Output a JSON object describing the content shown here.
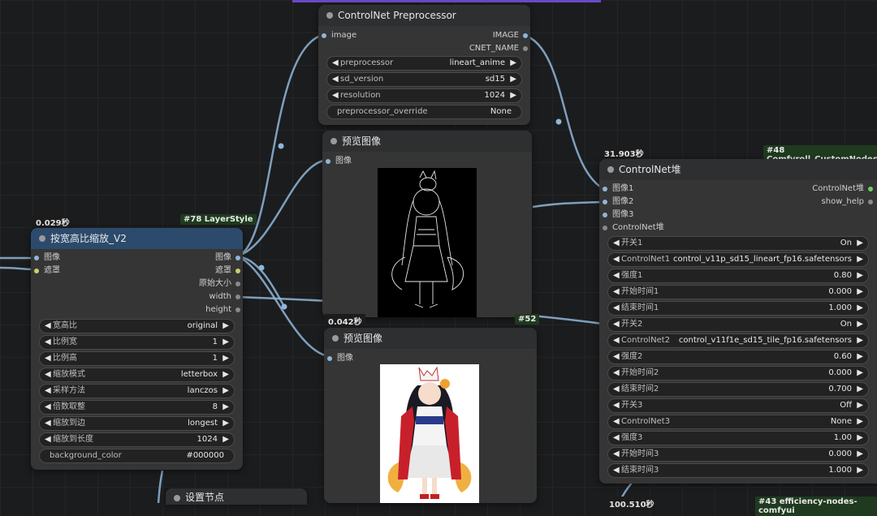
{
  "nodes": {
    "preprocessor": {
      "title": "ControlNet Preprocessor",
      "input_image": "image",
      "out_image": "IMAGE",
      "out_cnet": "CNET_NAME",
      "widgets": [
        {
          "label": "preprocessor",
          "value": "lineart_anime"
        },
        {
          "label": "sd_version",
          "value": "sd15"
        },
        {
          "label": "resolution",
          "value": "1024"
        }
      ],
      "override": {
        "label": "preprocessor_override",
        "value": "None"
      }
    },
    "preview1": {
      "title": "预览图像",
      "input": "图像"
    },
    "preview2": {
      "title": "预览图像",
      "input": "图像",
      "time": "0.042秒",
      "badge": "#52"
    },
    "resize": {
      "title": "按宽高比缩放_V2",
      "time": "0.029秒",
      "badge": "#78 LayerStyle",
      "inputs": [
        "图像",
        "遮罩"
      ],
      "outputs": [
        "图像",
        "遮罩",
        "原始大小",
        "width",
        "height"
      ],
      "widgets": [
        {
          "label": "宽高比",
          "value": "original"
        },
        {
          "label": "比例宽",
          "value": "1"
        },
        {
          "label": "比例高",
          "value": "1"
        },
        {
          "label": "缩放模式",
          "value": "letterbox"
        },
        {
          "label": "采样方法",
          "value": "lanczos"
        },
        {
          "label": "倍数取整",
          "value": "8"
        },
        {
          "label": "缩放到边",
          "value": "longest"
        },
        {
          "label": "缩放到长度",
          "value": "1024"
        }
      ],
      "color": {
        "label": "background_color",
        "value": "#000000"
      }
    },
    "stack": {
      "title": "ControlNet堆",
      "time": "31.903秒",
      "badge": "#48 Comfyroll_CustomNodes",
      "inputs": [
        "图像1",
        "图像2",
        "图像3",
        "ControlNet堆"
      ],
      "outputs": [
        "ControlNet堆",
        "show_help"
      ],
      "widgets": [
        {
          "label": "开关1",
          "value": "On"
        },
        {
          "label": "ControlNet1",
          "value": "control_v11p_sd15_lineart_fp16.safetensors"
        },
        {
          "label": "强度1",
          "value": "0.80"
        },
        {
          "label": "开始时间1",
          "value": "0.000"
        },
        {
          "label": "结束时间1",
          "value": "1.000"
        },
        {
          "label": "开关2",
          "value": "On"
        },
        {
          "label": "ControlNet2",
          "value": "control_v11f1e_sd15_tile_fp16.safetensors"
        },
        {
          "label": "强度2",
          "value": "0.60"
        },
        {
          "label": "开始时间2",
          "value": "0.000"
        },
        {
          "label": "结束时间2",
          "value": "0.700"
        },
        {
          "label": "开关3",
          "value": "Off"
        },
        {
          "label": "ControlNet3",
          "value": "None"
        },
        {
          "label": "强度3",
          "value": "1.00"
        },
        {
          "label": "开始时间3",
          "value": "0.000"
        },
        {
          "label": "结束时间3",
          "value": "1.000"
        }
      ]
    },
    "settings": {
      "title": "设置节点"
    },
    "bottom_right": {
      "time": "100.510秒",
      "badge": "#43 efficiency-nodes-comfyui"
    }
  },
  "colors": {
    "canvas": "#1b1c1e",
    "node": "#353535",
    "wire": "#8fb6d8",
    "title_blue": "#2c4a6b"
  },
  "icons": {
    "left_arrow": "◀",
    "right_arrow": "▶"
  }
}
